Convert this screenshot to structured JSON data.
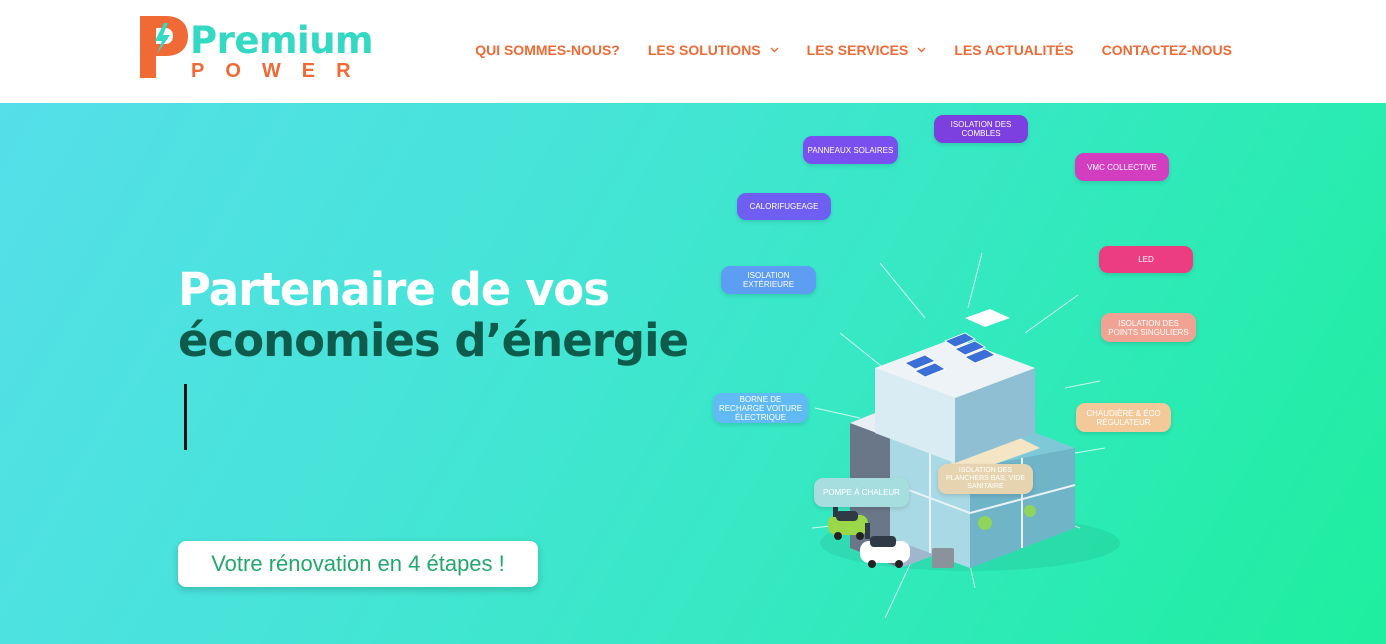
{
  "header": {
    "logo": {
      "word1": "Premium",
      "word2": "POWER"
    },
    "nav": [
      {
        "label": "QUI SOMMES-NOUS?",
        "has_dropdown": false
      },
      {
        "label": "LES SOLUTIONS",
        "has_dropdown": true
      },
      {
        "label": "LES SERVICES",
        "has_dropdown": true
      },
      {
        "label": "LES ACTUALITÉS",
        "has_dropdown": false
      },
      {
        "label": "CONTACTEZ-NOUS",
        "has_dropdown": false
      }
    ]
  },
  "hero": {
    "title_line1": "Partenaire de vos",
    "title_line2": "économies d’énergie",
    "cta_label": "Votre rénovation en 4 étapes !"
  },
  "illustration": {
    "tags": {
      "panneaux": "PANNEAUX SOLAIRES",
      "isolation_combles": "ISOLATION DES COMBLES",
      "vmc": "VMC COLLECTIVE",
      "calorifugeage": "CALORIFUGEAGE",
      "led": "LED",
      "isolation_exterieure": "ISOLATION EXTÉRIEURE",
      "isolation_points": "ISOLATION DES POINTS SINGULIERS",
      "borne": "BORNE DE RECHARGE VOITURE ÉLECTRIQUE",
      "chaudiere": "CHAUDIÈRE & ÉCO RÉGULATEUR",
      "isolation_planchers": "ISOLATION DES PLANCHERS BAS, VIDE SANITAIRE",
      "pompe": "POMPE À CHALEUR"
    }
  },
  "colors": {
    "accent_orange": "#f06a35",
    "logo_teal": "#34d9c3",
    "title_dark_green": "#0e5b4b",
    "cta_green": "#22a86c"
  }
}
